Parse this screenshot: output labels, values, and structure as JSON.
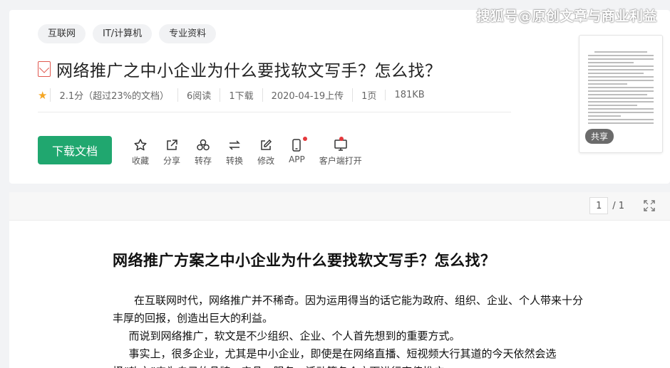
{
  "watermark": "搜狐号@原创文章与商业利益",
  "tags": [
    "互联网",
    "IT/计算机",
    "专业资料"
  ],
  "doc": {
    "title": "网络推广之中小企业为什么要找软文写手？怎么找？",
    "rating": "2.1分（超过23%的文档）",
    "reads": "6阅读",
    "downloads": "1下载",
    "upload_date": "2020-04-19上传",
    "pages": "1页",
    "size": "181KB"
  },
  "download_label": "下载文档",
  "actions": [
    {
      "label": "收藏",
      "icon": "star-icon"
    },
    {
      "label": "分享",
      "icon": "share-icon"
    },
    {
      "label": "转存",
      "icon": "save-to-icon"
    },
    {
      "label": "转换",
      "icon": "convert-icon"
    },
    {
      "label": "修改",
      "icon": "edit-icon"
    },
    {
      "label": "APP",
      "icon": "phone-icon"
    },
    {
      "label": "客户端打开",
      "icon": "monitor-icon"
    }
  ],
  "thumb_badge": "共享",
  "viewer": {
    "current_page": "1",
    "total_pages": "/ 1"
  },
  "content": {
    "heading": "网络推广方案之中小企业为什么要找软文写手？怎么找？",
    "paragraphs": [
      "在互联网时代，网络推广并不稀奇。因为运用得当的话它能为政府、组织、企业、个人带来十分丰厚的回报，创造出巨大的利益。",
      "而说到网络推广，软文是不少组织、企业、个人首先想到的重要方式。",
      "事实上，很多企业，尤其是中小企业，即使是在网络直播、短视频大行其道的今天依然会选择“软文”来为自己的品牌、产品、服务、活动等各个方面进行宣传推广。"
    ]
  },
  "colors": {
    "primary": "#20a76f",
    "star": "#f5a623",
    "pdf": "#e0584f",
    "notification_dot": "#e5383b"
  }
}
